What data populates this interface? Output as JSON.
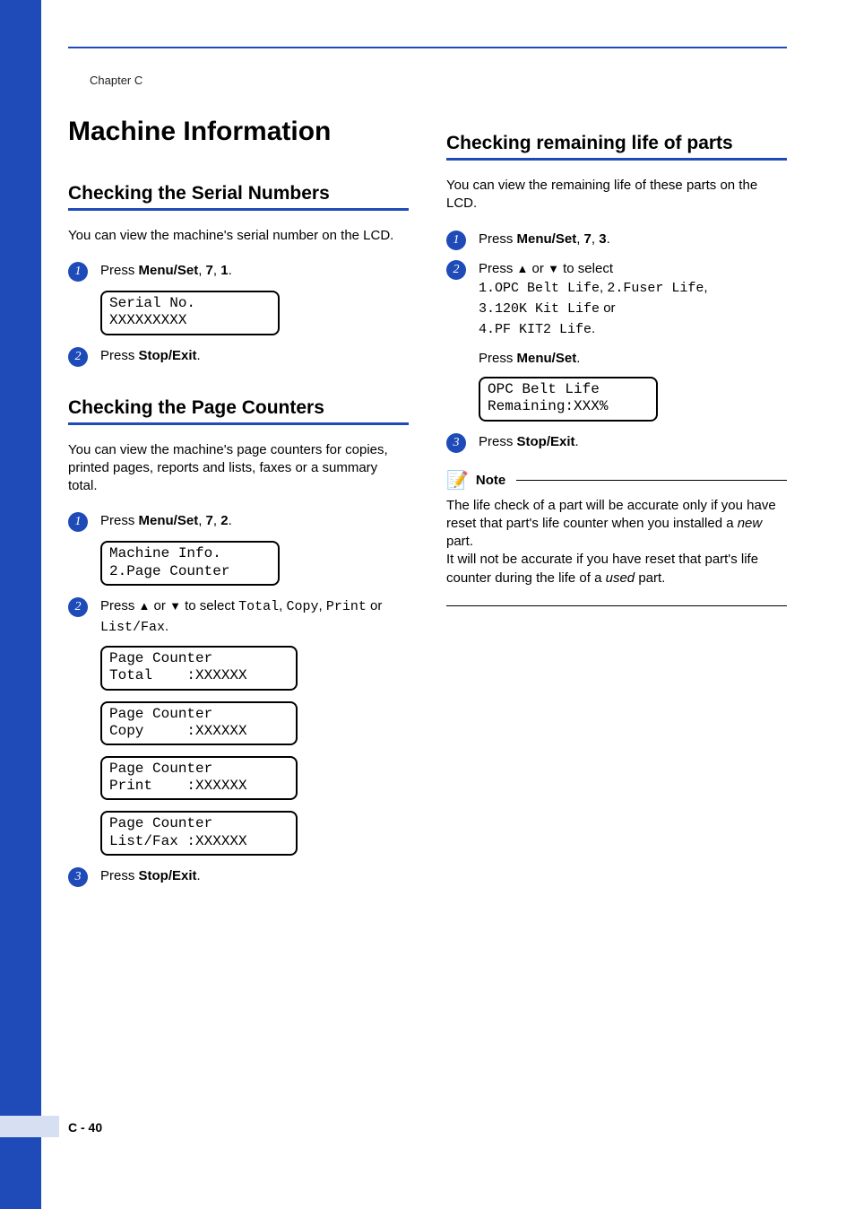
{
  "chapter": "Chapter C",
  "main_title": "Machine Information",
  "page_footer": "C - 40",
  "left": {
    "s1": {
      "heading": "Checking the Serial Numbers",
      "intro": "You can view the machine's serial number on the LCD.",
      "step1_pre": "Press ",
      "step1_b1": "Menu/Set",
      "step1_mid1": ", ",
      "step1_b2": "7",
      "step1_mid2": ", ",
      "step1_b3": "1",
      "step1_post": ".",
      "lcd1_l1": "Serial No.",
      "lcd1_l2": "XXXXXXXXX",
      "step2_pre": "Press ",
      "step2_b1": "Stop/Exit",
      "step2_post": "."
    },
    "s2": {
      "heading": "Checking the Page Counters",
      "intro": "You can view the machine's page counters for copies, printed pages, reports and lists, faxes or a summary total.",
      "step1_pre": "Press ",
      "step1_b1": "Menu/Set",
      "step1_mid1": ", ",
      "step1_b2": "7",
      "step1_mid2": ", ",
      "step1_b3": "2",
      "step1_post": ".",
      "lcd1_l1": "Machine Info.",
      "lcd1_l2": "2.Page Counter",
      "step2_pre": "Press ",
      "step2_or1": " or ",
      "step2_mid1": " to select ",
      "step2_m1": "Total",
      "step2_c1": ", ",
      "step2_m2": "Copy",
      "step2_c2": ", ",
      "step2_m3": "Print",
      "step2_or2": " or ",
      "step2_m4": "List/Fax",
      "step2_post": ".",
      "lcd2_l1": "Page Counter",
      "lcd2_l2": "Total    :XXXXXX",
      "lcd3_l1": "Page Counter",
      "lcd3_l2": "Copy     :XXXXXX",
      "lcd4_l1": "Page Counter",
      "lcd4_l2": "Print    :XXXXXX",
      "lcd5_l1": "Page Counter",
      "lcd5_l2": "List/Fax :XXXXXX",
      "step3_pre": "Press ",
      "step3_b1": "Stop/Exit",
      "step3_post": "."
    }
  },
  "right": {
    "s1": {
      "heading": "Checking remaining life of parts",
      "intro": "You can view the remaining life of these parts on the LCD.",
      "step1_pre": "Press ",
      "step1_b1": "Menu/Set",
      "step1_mid1": ", ",
      "step1_b2": "7",
      "step1_mid2": ", ",
      "step1_b3": "3",
      "step1_post": ".",
      "step2_pre": "Press ",
      "step2_or1": " or ",
      "step2_mid1": " to select",
      "step2_m1": "1.OPC Belt Life",
      "step2_c1": ", ",
      "step2_m2": "2.Fuser Life",
      "step2_c2": ", ",
      "step2_m3": "3.120K Kit Life",
      "step2_or2": " or",
      "step2_m4": "4.PF KIT2 Life",
      "step2_post": ".",
      "step2_press": "Press ",
      "step2_bms": "Menu/Set",
      "step2_press_post": ".",
      "lcd1_l1": "OPC Belt Life",
      "lcd1_l2": "Remaining:XXX%",
      "step3_pre": "Press ",
      "step3_b1": "Stop/Exit",
      "step3_post": ".",
      "note_label": "Note",
      "note_p1a": "The life check of a part will be accurate only if you have reset that part's life counter when you installed a ",
      "note_p1i": "new",
      "note_p1b": " part.",
      "note_p2a": "It will not be accurate if you have reset that part's life counter during the life of a ",
      "note_p2i": "used",
      "note_p2b": " part."
    }
  }
}
